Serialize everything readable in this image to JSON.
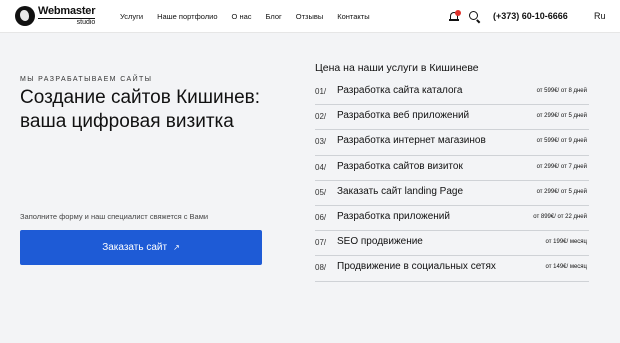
{
  "header": {
    "logo_title": "Webmaster",
    "logo_sub": "studio",
    "nav": [
      "Услуги",
      "Наше портфолио",
      "О нас",
      "Блог",
      "Отзывы",
      "Контакты"
    ],
    "phone": "(+373) 60-10-6666",
    "lang": "Ru"
  },
  "hero": {
    "kicker": "Мы разрабатываем сайты",
    "title": "Создание сайтов Кишинев: ваша цифровая визитка",
    "note": "Заполните форму и наш специалист свяжется с Вами",
    "button_label": "Заказать сайт",
    "button_arrow": "↗"
  },
  "prices": {
    "title": "Цена на наши услуги в Кишиневе",
    "items": [
      {
        "num": "01/",
        "name": "Разработка сайта каталога",
        "price": "от 599€/ от 8 дней"
      },
      {
        "num": "02/",
        "name": "Разработка веб приложений",
        "price": "от 299€/ от 5 дней"
      },
      {
        "num": "03/",
        "name": "Разработка интернет магазинов",
        "price": "от 599€/ от 9 дней"
      },
      {
        "num": "04/",
        "name": "Разработка сайтов визиток",
        "price": "от 299€/ от 7 дней"
      },
      {
        "num": "05/",
        "name": "Заказать сайт landing Page",
        "price": "от 299€/ от 5 дней"
      },
      {
        "num": "06/",
        "name": "Разработка приложений",
        "price": "от 899€/ от 22 дней"
      },
      {
        "num": "07/",
        "name": "SEO продвижение",
        "price": "от 199€/ месяц"
      },
      {
        "num": "08/",
        "name": "Продвижение в социальных сетях",
        "price": "от 149€/ месяц"
      }
    ]
  },
  "colors": {
    "accent": "#1e5bd6",
    "notification": "#e0322b",
    "background": "#f3f4f6"
  },
  "icons": [
    "globe-logo-icon",
    "bell-icon",
    "search-icon",
    "arrow-up-right-icon"
  ]
}
